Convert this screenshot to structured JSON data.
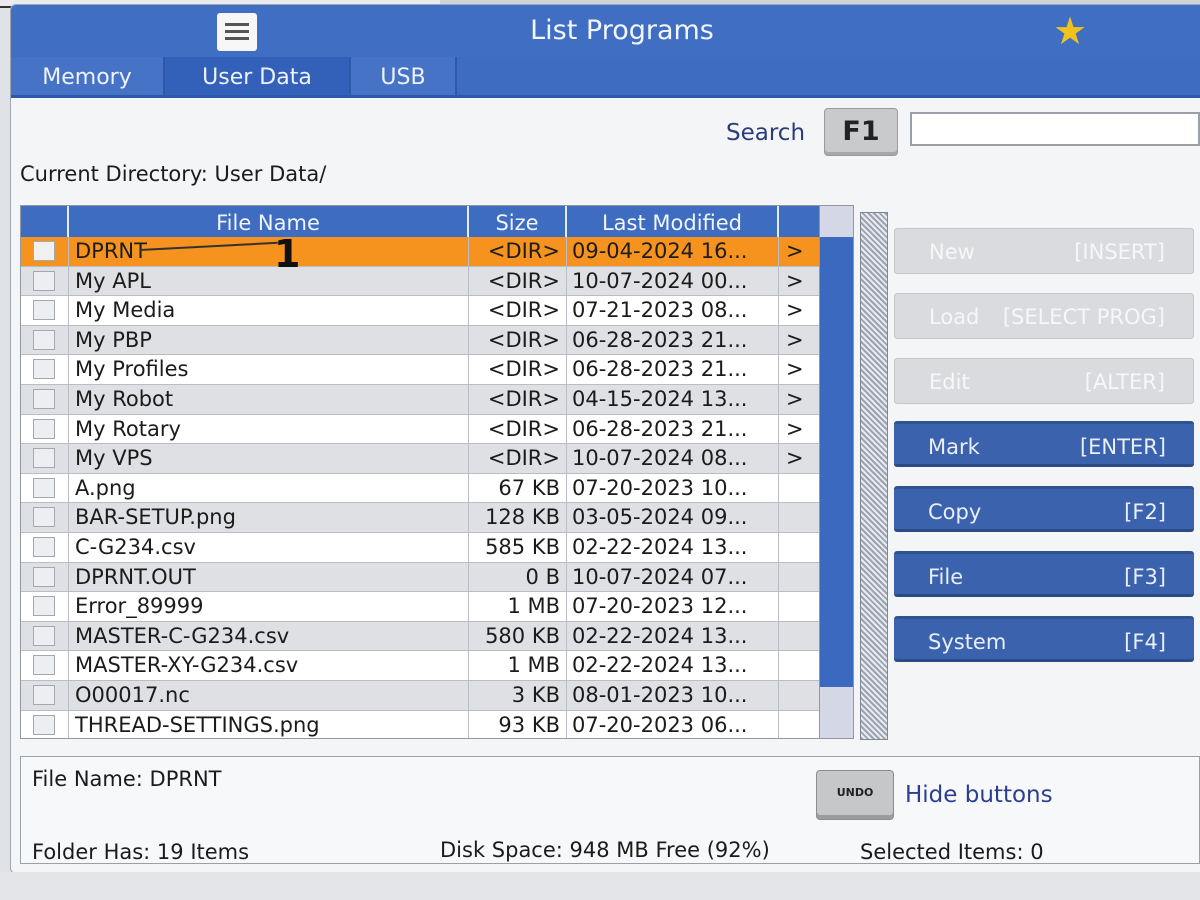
{
  "window": {
    "title": "List Programs"
  },
  "tabs": [
    "Memory",
    "User Data",
    "USB"
  ],
  "search": {
    "label": "Search",
    "key": "F1",
    "value": ""
  },
  "current_directory": "Current Directory: User Data/",
  "columns": {
    "name": "File Name",
    "size": "Size",
    "modified": "Last Modified"
  },
  "files": [
    {
      "name": "DPRNT",
      "size": "<DIR>",
      "modified": "09-04-2024 16...",
      "arrow": ">",
      "selected": true
    },
    {
      "name": "My APL",
      "size": "<DIR>",
      "modified": "10-07-2024 00...",
      "arrow": ">"
    },
    {
      "name": "My Media",
      "size": "<DIR>",
      "modified": "07-21-2023 08...",
      "arrow": ">"
    },
    {
      "name": "My PBP",
      "size": "<DIR>",
      "modified": "06-28-2023 21...",
      "arrow": ">"
    },
    {
      "name": "My Profiles",
      "size": "<DIR>",
      "modified": "06-28-2023 21...",
      "arrow": ">"
    },
    {
      "name": "My Robot",
      "size": "<DIR>",
      "modified": "04-15-2024 13...",
      "arrow": ">"
    },
    {
      "name": "My Rotary",
      "size": "<DIR>",
      "modified": "06-28-2023 21...",
      "arrow": ">"
    },
    {
      "name": "My VPS",
      "size": "<DIR>",
      "modified": "10-07-2024 08...",
      "arrow": ">"
    },
    {
      "name": "A.png",
      "size": "67 KB",
      "modified": "07-20-2023 10...",
      "arrow": ""
    },
    {
      "name": "BAR-SETUP.png",
      "size": "128 KB",
      "modified": "03-05-2024 09...",
      "arrow": ""
    },
    {
      "name": "C-G234.csv",
      "size": "585 KB",
      "modified": "02-22-2024 13...",
      "arrow": ""
    },
    {
      "name": "DPRNT.OUT",
      "size": "0 B",
      "modified": "10-07-2024 07...",
      "arrow": ""
    },
    {
      "name": "Error_89999",
      "size": "1 MB",
      "modified": "07-20-2023 12...",
      "arrow": ""
    },
    {
      "name": "MASTER-C-G234.csv",
      "size": "580 KB",
      "modified": "02-22-2024 13...",
      "arrow": ""
    },
    {
      "name": "MASTER-XY-G234.csv",
      "size": "1 MB",
      "modified": "02-22-2024 13...",
      "arrow": ""
    },
    {
      "name": "O00017.nc",
      "size": "3 KB",
      "modified": "08-01-2023 10...",
      "arrow": ""
    },
    {
      "name": "THREAD-SETTINGS.png",
      "size": "93 KB",
      "modified": "07-20-2023 06...",
      "arrow": ""
    }
  ],
  "callout": "1",
  "side_buttons": [
    {
      "label": "New",
      "key": "[INSERT]",
      "enabled": false
    },
    {
      "label": "Load",
      "key": "[SELECT PROG]",
      "enabled": false
    },
    {
      "label": "Edit",
      "key": "[ALTER]",
      "enabled": false
    },
    {
      "label": "Mark",
      "key": "[ENTER]",
      "enabled": true
    },
    {
      "label": "Copy",
      "key": "[F2]",
      "enabled": true
    },
    {
      "label": "File",
      "key": "[F3]",
      "enabled": true
    },
    {
      "label": "System",
      "key": "[F4]",
      "enabled": true
    }
  ],
  "status": {
    "file_name": "File Name: DPRNT",
    "folder_count": "Folder Has: 19 Items",
    "disk_space": "Disk Space: 948 MB Free (92%)",
    "selected_items": "Selected Items: 0"
  },
  "undo_label": "UNDO",
  "hide_buttons": "Hide buttons",
  "colors": {
    "accent": "#3d6cc1",
    "selected_row": "#f6921e",
    "star": "#f1c21b"
  },
  "icons": [
    "hamburger-menu-icon",
    "star-icon"
  ]
}
